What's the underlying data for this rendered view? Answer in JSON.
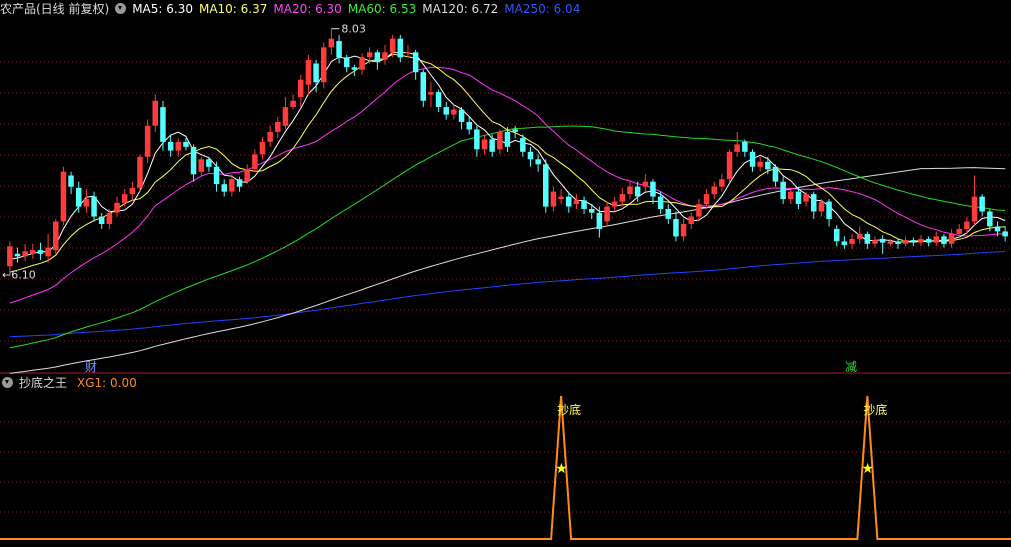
{
  "main": {
    "title": "农产品(日线 前复权)",
    "ma_labels": [
      {
        "text": "MA5: 6.30",
        "color": "#ffffff"
      },
      {
        "text": "MA10: 6.37",
        "color": "#ffff66"
      },
      {
        "text": "MA20: 6.30",
        "color": "#ff44ff"
      },
      {
        "text": "MA60: 6.53",
        "color": "#33ee33"
      },
      {
        "text": "MA120: 6.72",
        "color": "#dddddd"
      },
      {
        "text": "MA250: 6.04",
        "color": "#3355ff"
      }
    ],
    "high_label": "8.03",
    "low_label": "6.10",
    "markers": [
      "财",
      "减"
    ]
  },
  "indicator": {
    "title": "抄底之王",
    "value_label": "XG1: 0.00",
    "signal_label": "抄底"
  },
  "colors": {
    "up": "#ff3b3b",
    "down": "#54ffff",
    "grid": "#8a1e1e",
    "ind_line": "#ff8c1a",
    "star": "#ffff00"
  },
  "chart_data": {
    "type": "candlestick",
    "price_range": [
      5.35,
      8.1
    ],
    "high": 8.03,
    "low": 6.1,
    "candles": [
      [
        6.12,
        6.28,
        6.05,
        6.32
      ],
      [
        6.22,
        6.2,
        6.15,
        6.27
      ],
      [
        6.2,
        6.24,
        6.16,
        6.3
      ],
      [
        6.22,
        6.25,
        6.18,
        6.3
      ],
      [
        6.25,
        6.22,
        6.17,
        6.31
      ],
      [
        6.2,
        6.27,
        6.15,
        6.38
      ],
      [
        6.25,
        6.48,
        6.22,
        6.5
      ],
      [
        6.48,
        6.88,
        6.45,
        6.92
      ],
      [
        6.85,
        6.76,
        6.7,
        6.88
      ],
      [
        6.75,
        6.6,
        6.55,
        6.8
      ],
      [
        6.6,
        6.66,
        6.55,
        6.74
      ],
      [
        6.68,
        6.52,
        6.48,
        6.72
      ],
      [
        6.52,
        6.46,
        6.42,
        6.55
      ],
      [
        6.46,
        6.55,
        6.42,
        6.58
      ],
      [
        6.55,
        6.63,
        6.52,
        6.68
      ],
      [
        6.63,
        6.7,
        6.6,
        6.74
      ],
      [
        6.7,
        6.75,
        6.65,
        6.8
      ],
      [
        6.75,
        7.0,
        6.72,
        7.02
      ],
      [
        7.0,
        7.25,
        6.95,
        7.3
      ],
      [
        7.25,
        7.45,
        7.2,
        7.5
      ],
      [
        7.4,
        7.12,
        7.05,
        7.45
      ],
      [
        7.12,
        7.05,
        7.0,
        7.18
      ],
      [
        7.05,
        7.12,
        7.0,
        7.15
      ],
      [
        7.12,
        7.08,
        7.05,
        7.15
      ],
      [
        7.08,
        6.86,
        6.8,
        7.1
      ],
      [
        6.88,
        6.98,
        6.85,
        7.0
      ],
      [
        6.98,
        6.92,
        6.88,
        7.0
      ],
      [
        6.92,
        6.78,
        6.72,
        6.96
      ],
      [
        6.78,
        6.72,
        6.68,
        6.82
      ],
      [
        6.72,
        6.82,
        6.68,
        6.86
      ],
      [
        6.82,
        6.76,
        6.72,
        6.84
      ],
      [
        6.8,
        6.9,
        6.78,
        6.94
      ],
      [
        6.9,
        7.02,
        6.88,
        7.06
      ],
      [
        7.02,
        7.12,
        6.98,
        7.16
      ],
      [
        7.12,
        7.2,
        7.08,
        7.25
      ],
      [
        7.2,
        7.28,
        7.15,
        7.32
      ],
      [
        7.25,
        7.4,
        7.22,
        7.48
      ],
      [
        7.4,
        7.45,
        7.38,
        7.5
      ],
      [
        7.48,
        7.62,
        7.4,
        7.66
      ],
      [
        7.58,
        7.78,
        7.5,
        7.82
      ],
      [
        7.75,
        7.6,
        7.52,
        7.78
      ],
      [
        7.6,
        7.88,
        7.55,
        7.92
      ],
      [
        7.88,
        7.95,
        7.82,
        8.03
      ],
      [
        7.93,
        7.8,
        7.75,
        7.98
      ],
      [
        7.8,
        7.72,
        7.68,
        7.82
      ],
      [
        7.72,
        7.7,
        7.65,
        7.74
      ],
      [
        7.7,
        7.8,
        7.66,
        7.83
      ],
      [
        7.8,
        7.84,
        7.75,
        7.88
      ],
      [
        7.84,
        7.76,
        7.7,
        7.86
      ],
      [
        7.78,
        7.84,
        7.74,
        7.9
      ],
      [
        7.84,
        7.95,
        7.8,
        7.98
      ],
      [
        7.95,
        7.8,
        7.76,
        7.98
      ],
      [
        7.84,
        7.84,
        7.8,
        7.9
      ],
      [
        7.84,
        7.68,
        7.62,
        7.86
      ],
      [
        7.68,
        7.45,
        7.4,
        7.7
      ],
      [
        7.5,
        7.52,
        7.4,
        7.6
      ],
      [
        7.52,
        7.4,
        7.36,
        7.54
      ],
      [
        7.4,
        7.34,
        7.3,
        7.44
      ],
      [
        7.34,
        7.38,
        7.3,
        7.42
      ],
      [
        7.38,
        7.28,
        7.22,
        7.4
      ],
      [
        7.28,
        7.22,
        7.18,
        7.32
      ],
      [
        7.22,
        7.06,
        7.0,
        7.25
      ],
      [
        7.06,
        7.14,
        7.02,
        7.18
      ],
      [
        7.14,
        7.04,
        7.0,
        7.18
      ],
      [
        7.06,
        7.2,
        7.02,
        7.22
      ],
      [
        7.2,
        7.08,
        7.04,
        7.24
      ],
      [
        7.22,
        7.2,
        7.15,
        7.25
      ],
      [
        7.15,
        7.04,
        7.0,
        7.18
      ],
      [
        7.04,
        6.98,
        6.92,
        7.08
      ],
      [
        6.98,
        6.94,
        6.88,
        7.02
      ],
      [
        6.94,
        6.6,
        6.55,
        6.98
      ],
      [
        6.6,
        6.72,
        6.56,
        6.76
      ],
      [
        6.66,
        6.68,
        6.62,
        6.74
      ],
      [
        6.68,
        6.6,
        6.55,
        6.72
      ],
      [
        6.62,
        6.65,
        6.58,
        6.7
      ],
      [
        6.65,
        6.58,
        6.54,
        6.68
      ],
      [
        6.58,
        6.55,
        6.5,
        6.62
      ],
      [
        6.55,
        6.42,
        6.35,
        6.6
      ],
      [
        6.48,
        6.6,
        6.44,
        6.64
      ],
      [
        6.6,
        6.64,
        6.56,
        6.68
      ],
      [
        6.64,
        6.7,
        6.6,
        6.75
      ],
      [
        6.7,
        6.76,
        6.66,
        6.8
      ],
      [
        6.76,
        6.68,
        6.64,
        6.8
      ],
      [
        6.76,
        6.8,
        6.72,
        6.86
      ],
      [
        6.8,
        6.68,
        6.62,
        6.82
      ],
      [
        6.68,
        6.58,
        6.54,
        6.72
      ],
      [
        6.58,
        6.5,
        6.46,
        6.62
      ],
      [
        6.5,
        6.36,
        6.32,
        6.56
      ],
      [
        6.36,
        6.46,
        6.32,
        6.5
      ],
      [
        6.46,
        6.52,
        6.42,
        6.55
      ],
      [
        6.52,
        6.62,
        6.48,
        6.66
      ],
      [
        6.62,
        6.7,
        6.58,
        6.74
      ],
      [
        6.7,
        6.76,
        6.66,
        6.8
      ],
      [
        6.76,
        6.82,
        6.72,
        6.86
      ],
      [
        6.82,
        7.04,
        6.8,
        7.06
      ],
      [
        7.04,
        7.1,
        7.0,
        7.2
      ],
      [
        7.12,
        7.04,
        7.0,
        7.14
      ],
      [
        7.04,
        6.92,
        6.88,
        7.06
      ],
      [
        6.92,
        6.96,
        6.88,
        7.0
      ],
      [
        6.96,
        6.9,
        6.86,
        7.0
      ],
      [
        6.92,
        6.8,
        6.76,
        6.94
      ],
      [
        6.8,
        6.66,
        6.62,
        6.84
      ],
      [
        6.66,
        6.72,
        6.62,
        6.74
      ],
      [
        6.72,
        6.62,
        6.58,
        6.76
      ],
      [
        6.64,
        6.7,
        6.6,
        6.72
      ],
      [
        6.7,
        6.56,
        6.5,
        6.72
      ],
      [
        6.56,
        6.64,
        6.52,
        6.66
      ],
      [
        6.64,
        6.5,
        6.44,
        6.66
      ],
      [
        6.42,
        6.32,
        6.28,
        6.45
      ],
      [
        6.32,
        6.29,
        6.26,
        6.36
      ],
      [
        6.3,
        6.34,
        6.26,
        6.38
      ],
      [
        6.34,
        6.38,
        6.3,
        6.44
      ],
      [
        6.38,
        6.3,
        6.26,
        6.4
      ],
      [
        6.3,
        6.33,
        6.27,
        6.36
      ],
      [
        6.34,
        6.31,
        6.22,
        6.37
      ],
      [
        6.3,
        6.32,
        6.28,
        6.34
      ],
      [
        6.32,
        6.3,
        6.26,
        6.34
      ],
      [
        6.3,
        6.33,
        6.28,
        6.36
      ],
      [
        6.33,
        6.31,
        6.28,
        6.35
      ],
      [
        6.31,
        6.34,
        6.28,
        6.37
      ],
      [
        6.34,
        6.31,
        6.28,
        6.36
      ],
      [
        6.31,
        6.36,
        6.28,
        6.4
      ],
      [
        6.36,
        6.3,
        6.27,
        6.38
      ],
      [
        6.3,
        6.38,
        6.27,
        6.42
      ],
      [
        6.38,
        6.42,
        6.35,
        6.46
      ],
      [
        6.42,
        6.48,
        6.38,
        6.52
      ],
      [
        6.48,
        6.68,
        6.45,
        6.85
      ],
      [
        6.68,
        6.56,
        6.52,
        6.7
      ],
      [
        6.56,
        6.44,
        6.4,
        6.58
      ],
      [
        6.44,
        6.4,
        6.36,
        6.48
      ],
      [
        6.4,
        6.36,
        6.32,
        6.44
      ]
    ],
    "signal_days": [
      72,
      112
    ]
  }
}
